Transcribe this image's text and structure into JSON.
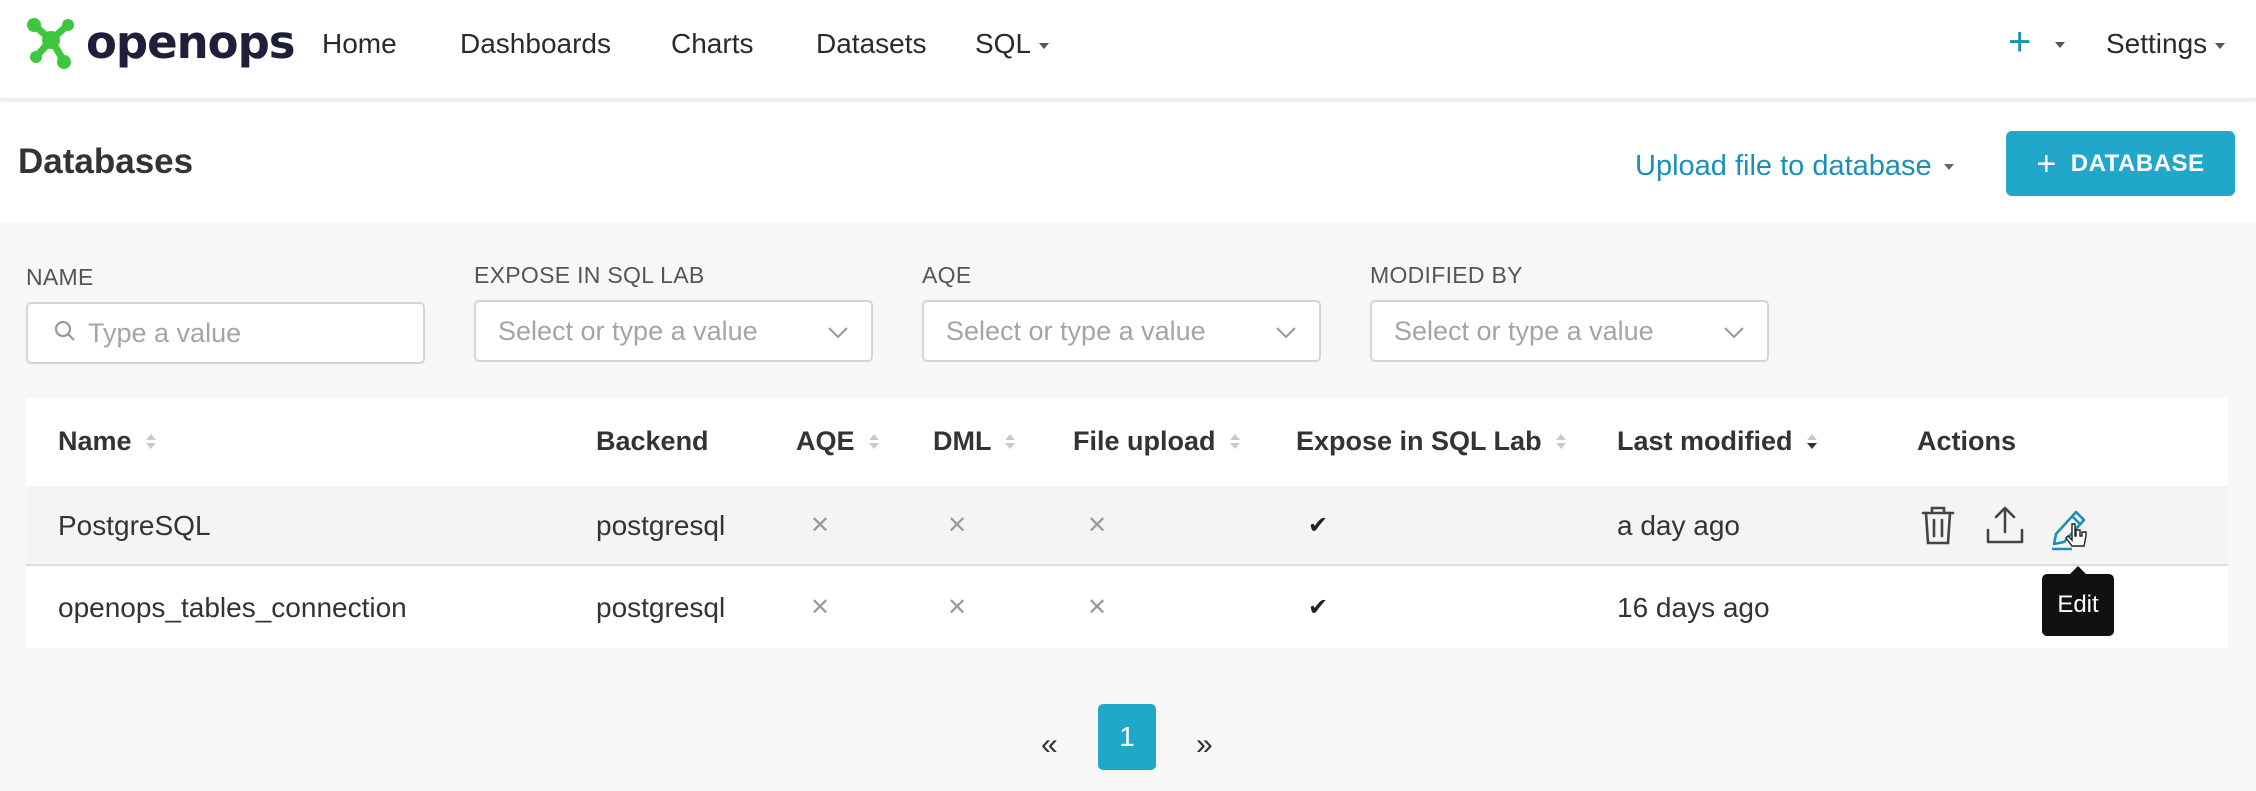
{
  "app": {
    "logo_text": "openops",
    "brand_color": "#1c8fb7",
    "logo_color": "#3ec73e"
  },
  "nav": {
    "items": [
      "Home",
      "Dashboards",
      "Charts",
      "Datasets",
      "SQL"
    ],
    "plus_label": "+",
    "settings_label": "Settings"
  },
  "header": {
    "title": "Databases",
    "upload_label": "Upload file to database",
    "add_button_plus": "+",
    "add_button_label": "DATABASE"
  },
  "filters": [
    {
      "label": "NAME",
      "placeholder": "Type a value",
      "icon": "search-icon"
    },
    {
      "label": "EXPOSE IN SQL LAB",
      "placeholder": "Select or type a value",
      "icon": "chevron-down-icon"
    },
    {
      "label": "AQE",
      "placeholder": "Select or type a value",
      "icon": "chevron-down-icon"
    },
    {
      "label": "MODIFIED BY",
      "placeholder": "Select or type a value",
      "icon": "chevron-down-icon"
    }
  ],
  "table": {
    "columns": [
      "Name",
      "Backend",
      "AQE",
      "DML",
      "File upload",
      "Expose in SQL Lab",
      "Last modified",
      "Actions"
    ],
    "rows": [
      {
        "name": "PostgreSQL",
        "backend": "postgresql",
        "aqe": "✕",
        "dml": "✕",
        "file_upload": "✕",
        "expose": "✔",
        "modified": "a day ago"
      },
      {
        "name": "openops_tables_connection",
        "backend": "postgresql",
        "aqe": "✕",
        "dml": "✕",
        "file_upload": "✕",
        "expose": "✔",
        "modified": "16 days ago"
      }
    ],
    "actions_icons": [
      "trash-icon",
      "upload-icon",
      "pencil-icon"
    ]
  },
  "tooltip": {
    "text": "Edit"
  },
  "pagination": {
    "prev": "«",
    "current": "1",
    "next": "»"
  }
}
